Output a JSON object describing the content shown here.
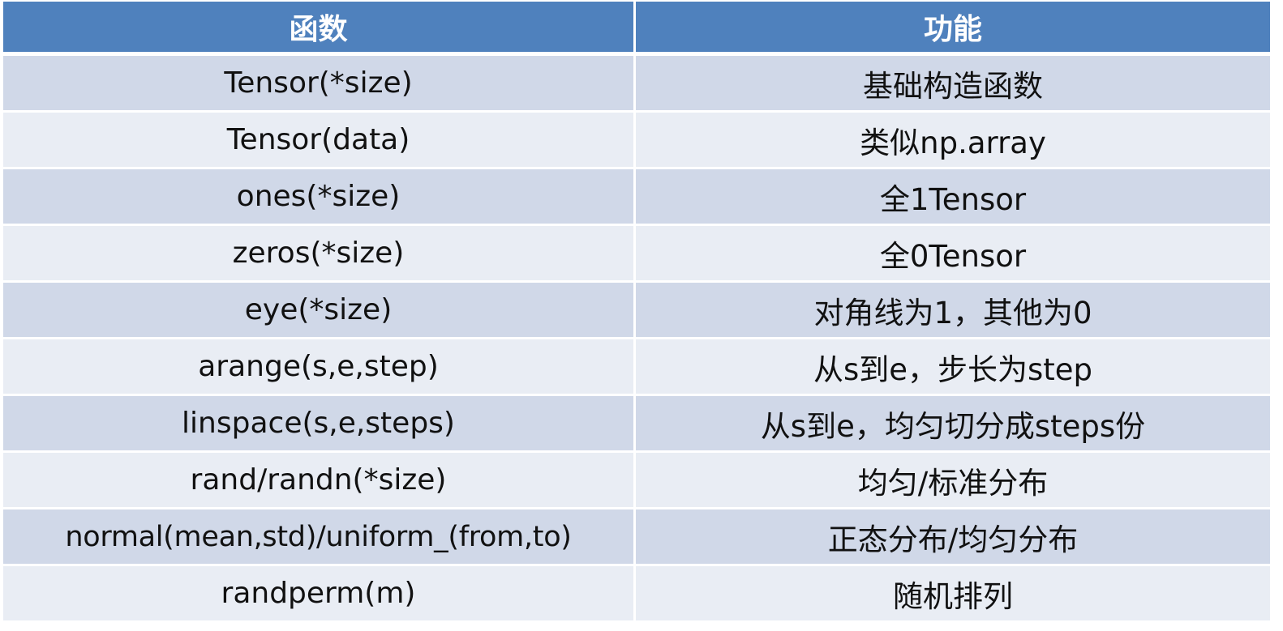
{
  "table": {
    "headers": [
      "函数",
      "功能"
    ],
    "rows": [
      {
        "function": "Tensor(*size)",
        "description": "基础构造函数"
      },
      {
        "function": "Tensor(data)",
        "description": "类似np.array"
      },
      {
        "function": "ones(*size)",
        "description": "全1Tensor"
      },
      {
        "function": "zeros(*size)",
        "description": "全0Tensor"
      },
      {
        "function": "eye(*size)",
        "description": "对角线为1，其他为0"
      },
      {
        "function": "arange(s,e,step)",
        "description": "从s到e，步长为step"
      },
      {
        "function": "linspace(s,e,steps)",
        "description": "从s到e，均匀切分成steps份"
      },
      {
        "function": "rand/randn(*size)",
        "description": "均匀/标准分布"
      },
      {
        "function": "normal(mean,std)/uniform_(from,to)",
        "description": "正态分布/均匀分布"
      },
      {
        "function": "randperm(m)",
        "description": "随机排列"
      }
    ]
  },
  "colors": {
    "header_bg": "#4f81bd",
    "header_text": "#ffffff",
    "row_odd_bg": "#d0d8e8",
    "row_even_bg": "#e9edf4",
    "body_text": "#111111"
  }
}
